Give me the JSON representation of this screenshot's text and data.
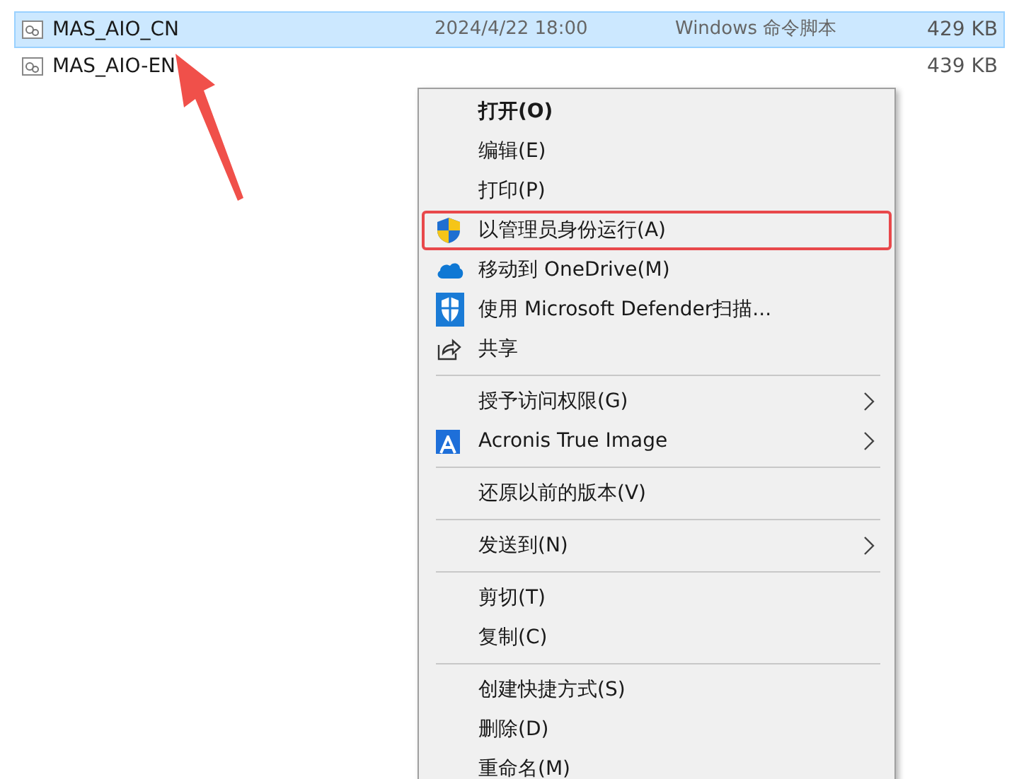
{
  "files": [
    {
      "name": "MAS_AIO_CN",
      "date": "2024/4/22 18:00",
      "type": "Windows 命令脚本",
      "size": "429 KB",
      "selected": true
    },
    {
      "name": "MAS_AIO-EN",
      "size": "439 KB",
      "selected": false
    }
  ],
  "context_menu": {
    "items": [
      {
        "kind": "item",
        "label": "打开(O)",
        "bold": true
      },
      {
        "kind": "item",
        "label": "编辑(E)"
      },
      {
        "kind": "item",
        "label": "打印(P)"
      },
      {
        "kind": "admin",
        "label": "以管理员身份运行(A)",
        "highlighted": true
      },
      {
        "kind": "cloud",
        "label": "移动到 OneDrive(M)"
      },
      {
        "kind": "defender",
        "label": "使用 Microsoft Defender扫描..."
      },
      {
        "kind": "share",
        "label": "共享"
      },
      {
        "kind": "separator"
      },
      {
        "kind": "item",
        "label": "授予访问权限(G)",
        "submenu": true
      },
      {
        "kind": "acronis",
        "label": "Acronis True Image",
        "submenu": true
      },
      {
        "kind": "separator"
      },
      {
        "kind": "item",
        "label": "还原以前的版本(V)"
      },
      {
        "kind": "separator"
      },
      {
        "kind": "item",
        "label": "发送到(N)",
        "submenu": true
      },
      {
        "kind": "separator"
      },
      {
        "kind": "item",
        "label": "剪切(T)"
      },
      {
        "kind": "item",
        "label": "复制(C)"
      },
      {
        "kind": "separator"
      },
      {
        "kind": "item",
        "label": "创建快捷方式(S)"
      },
      {
        "kind": "item",
        "label": "删除(D)"
      },
      {
        "kind": "item",
        "label": "重命名(M)"
      }
    ]
  }
}
